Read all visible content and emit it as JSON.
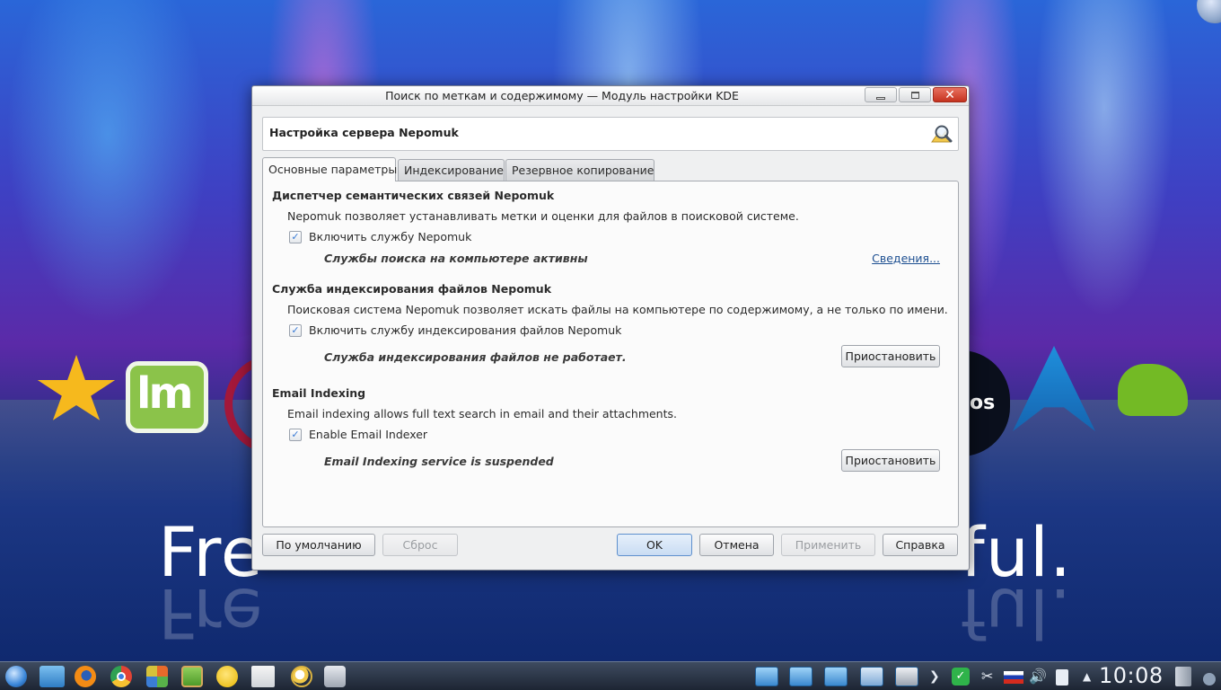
{
  "window": {
    "title": "Поиск по меткам и содержимому — Модуль настройки KDE",
    "header": "Настройка сервера Nepomuk",
    "tabs": [
      {
        "label": "Основные параметры",
        "active": true
      },
      {
        "label": "Индексирование",
        "active": false
      },
      {
        "label": "Резервное копирование",
        "active": false
      }
    ],
    "sections": {
      "semantic": {
        "title": "Диспетчер семантических связей Nepomuk",
        "description": "Nepomuk позволяет устанавливать метки и оценки для файлов в поисковой системе.",
        "checkbox_label": "Включить службу Nepomuk",
        "checked": true,
        "status": "Службы поиска на компьютере активны",
        "link": "Сведения..."
      },
      "files": {
        "title": "Служба индексирования файлов Nepomuk",
        "description": "Поисковая система Nepomuk позволяет искать файлы на компьютере по содержимому, а не только по имени.",
        "checkbox_label": "Включить службу индексирования файлов Nepomuk",
        "checked": true,
        "status": "Служба индексирования файлов не работает.",
        "button": "Приостановить"
      },
      "email": {
        "title": "Email Indexing",
        "description": "Email indexing allows full text search in email and their attachments.",
        "checkbox_label": "Enable Email Indexer",
        "checked": true,
        "status": "Email Indexing service is suspended",
        "button": "Приостановить"
      }
    },
    "buttons": {
      "defaults": "По умолчанию",
      "reset": "Сброс",
      "ok": "OK",
      "cancel": "Отмена",
      "apply": "Применить",
      "help": "Справка"
    }
  },
  "desktop": {
    "slogan_left": "Fre",
    "slogan_right": "ful.",
    "logo_text": "os",
    "logo_letters": "lm"
  },
  "taskbar": {
    "clock": "10:08"
  },
  "colors": {
    "accent": "#3a7bd5",
    "link": "#1d4f91",
    "close_button": "#c5331f"
  }
}
